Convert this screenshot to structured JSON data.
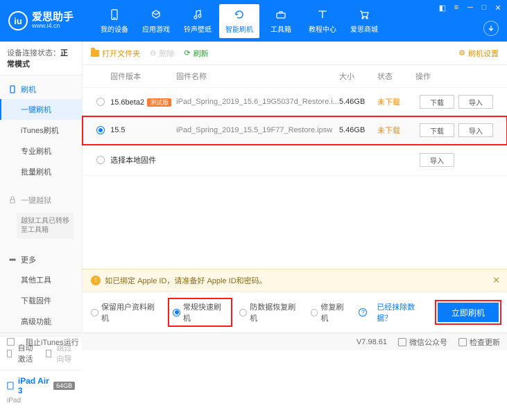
{
  "app": {
    "name": "爱思助手",
    "domain": "www.i4.cn"
  },
  "nav": {
    "items": [
      {
        "label": "我的设备"
      },
      {
        "label": "应用游戏"
      },
      {
        "label": "铃声壁纸"
      },
      {
        "label": "智能刷机"
      },
      {
        "label": "工具箱"
      },
      {
        "label": "教程中心"
      },
      {
        "label": "爱思商城"
      }
    ]
  },
  "sidebar": {
    "status_label": "设备连接状态：",
    "status_value": "正常模式",
    "g1_head": "刷机",
    "g1_items": [
      "一键刷机",
      "iTunes刷机",
      "专业刷机",
      "批量刷机"
    ],
    "g2_head": "一键越狱",
    "g2_note": "越狱工具已转移至工具箱",
    "g3_head": "更多",
    "g3_items": [
      "其他工具",
      "下载固件",
      "高级功能"
    ],
    "auto_activate": "自动激活",
    "skip_guide": "跳过向导",
    "device_name": "iPad Air 3",
    "device_cap": "64GB",
    "device_type": "iPad"
  },
  "toolbar": {
    "open": "打开文件夹",
    "delete": "删除",
    "refresh": "刷新",
    "settings": "刷机设置"
  },
  "table": {
    "h_ver": "固件版本",
    "h_name": "固件名称",
    "h_size": "大小",
    "h_stat": "状态",
    "h_ops": "操作",
    "rows": [
      {
        "ver": "15.6beta2",
        "tag": "测试版",
        "name": "iPad_Spring_2019_15.6_19G5037d_Restore.i...",
        "size": "5.46GB",
        "stat": "未下载"
      },
      {
        "ver": "15.5",
        "tag": "",
        "name": "iPad_Spring_2019_15.5_19F77_Restore.ipsw",
        "size": "5.46GB",
        "stat": "未下载"
      }
    ],
    "local": "选择本地固件",
    "btn_dl": "下载",
    "btn_imp": "导入"
  },
  "warn": "如已绑定 Apple ID，请准备好 Apple ID和密码。",
  "modes": {
    "m1": "保留用户资料刷机",
    "m2": "常规快速刷机",
    "m3": "防数据恢复刷机",
    "m4": "修复刷机",
    "link": "已经抹除数据？",
    "go": "立即刷机"
  },
  "status": {
    "block_itunes": "阻止iTunes运行",
    "version": "V7.98.61",
    "wechat": "微信公众号",
    "update": "检查更新"
  }
}
